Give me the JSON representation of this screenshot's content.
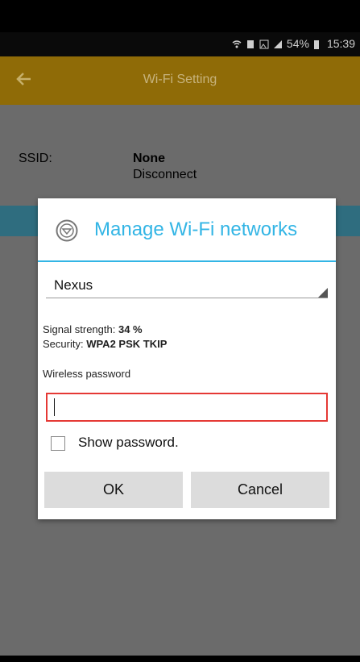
{
  "status_bar": {
    "battery_percent": "54%",
    "time": "15:39"
  },
  "app_bar": {
    "title": "Wi-Fi Setting"
  },
  "connection": {
    "ssid_label": "SSID:",
    "ssid_value": "None",
    "status": "Disconnect"
  },
  "dialog": {
    "title": "Manage Wi-Fi networks",
    "network_selected": "Nexus",
    "signal_label": "Signal strength:",
    "signal_value": "34 %",
    "security_label": "Security:",
    "security_value": "WPA2 PSK TKIP",
    "password_label": "Wireless password",
    "password_value": "",
    "show_password_label": "Show password.",
    "ok_label": "OK",
    "cancel_label": "Cancel"
  },
  "colors": {
    "accent": "#33b5e5",
    "app_bar": "#8f6b07",
    "input_border_error": "#e53935"
  }
}
